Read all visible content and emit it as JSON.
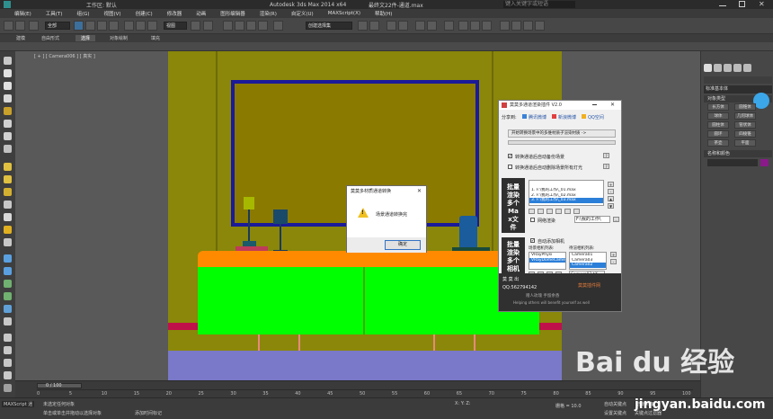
{
  "titlebar": {
    "quick_access": "工作区: 默认",
    "app_title": "Autodesk 3ds Max  2014 x64",
    "file_name": "最终文22件-通道.max",
    "search_placeholder": "键入关键字或短语"
  },
  "menubar": {
    "items": [
      "编辑(E)",
      "工具(T)",
      "组(G)",
      "视图(V)",
      "创建(C)",
      "修改器",
      "动画",
      "图形编辑器",
      "渲染(R)",
      "自定义(U)",
      "MAXScript(X)",
      "帮助(H)"
    ]
  },
  "toolbar": {
    "filter_select": "全部",
    "view_select": "视图",
    "selection_set": "创建选择集"
  },
  "ribbon": {
    "tabs": [
      "建模",
      "自由形式",
      "选择",
      "对象绘制",
      "填充"
    ],
    "active": "选择"
  },
  "viewport": {
    "label": "[ + ] [ Camera006 ] [ 真实 ]"
  },
  "plugin": {
    "title": "莫莫多通道渲染插件 V2.0",
    "share_label": "分享到:",
    "share_weibo": "腾讯微博",
    "share_sina": "新浪微博",
    "share_qzone": "QQ空间",
    "convert_button": "开始转换场景中的多维材质子渲染材质 ->",
    "opt_auto_save": "转换通道后自动备份场景",
    "opt_auto_delete": "转换通道后自动删除场景所有灯光",
    "section1_label": "批量渲染多个Max文件",
    "file_list": [
      "1. F:\\我的工作\\_01.max",
      "2. F:\\我的工作\\_02.max",
      "3. F:\\我的工作\\_03.max"
    ],
    "file_list_selected": 2,
    "net_render_label": "网络渲染",
    "path_field": "F:\\我的工作\\",
    "section2_label": "批量渲染多个相机",
    "auto_add_camera": "自动添加相机",
    "scene_camera_header": "场景相机列表:",
    "render_camera_header": "待渲相机列表:",
    "scene_cameras": [
      "VRayPhysi",
      "VRayDomeCamera"
    ],
    "render_cameras": [
      "Camera01",
      "Camera03",
      "Camera02"
    ],
    "render_cameras_selected": 2,
    "output_name": "Camera03.tif",
    "author_label": "莫 莫 出",
    "qq": "QQ:562794142",
    "link": "莫莫插件网",
    "slogan_cn": "赠人玫瑰 手留余香",
    "slogan_en": "Helping others will benefit yourself as well"
  },
  "dialog": {
    "title": "莫莫多材质通道转换",
    "message": "场景通道转换完",
    "ok_label": "确定"
  },
  "rightpanel": {
    "dropdown": "标准基本体",
    "object_type_header": "对象类型",
    "buttons": [
      "长方体",
      "圆锥体",
      "球体",
      "几何球体",
      "圆柱体",
      "管状体",
      "圆环",
      "四棱锥",
      "茶壶",
      "平面"
    ],
    "name_color_header": "名称和颜色"
  },
  "timeline": {
    "frame_display": "0 / 100",
    "ticks": [
      "0",
      "5",
      "10",
      "15",
      "20",
      "25",
      "30",
      "35",
      "40",
      "45",
      "50",
      "55",
      "60",
      "65",
      "70",
      "75",
      "80",
      "85",
      "90",
      "95",
      "100"
    ]
  },
  "statusbar": {
    "maxscript": "MAXScript 迷",
    "line1": "未选定任何对象",
    "line2": "单击或单击并拖动以选择对象",
    "coords": "X:  Y:  Z:",
    "grid": "栅格 = 10.0",
    "auto_key": "自动关键点",
    "set_key": "设置关键点",
    "filter": "选定对象",
    "key_filter": "关键点过滤器",
    "add_time_tag": "添加时间标记"
  },
  "watermark": {
    "logo": "Bai du 经验",
    "url": "jingyan.baidu.com"
  },
  "colors": {
    "scene_wall": "#8a870a",
    "painting_fill": "#8a7a00",
    "painting_frame": "#1a1a9a",
    "cabinet": "#00ff00",
    "cabinet_top": "#ff8a00",
    "floor": "#7a78c8",
    "selected": "#2c7fd8"
  }
}
